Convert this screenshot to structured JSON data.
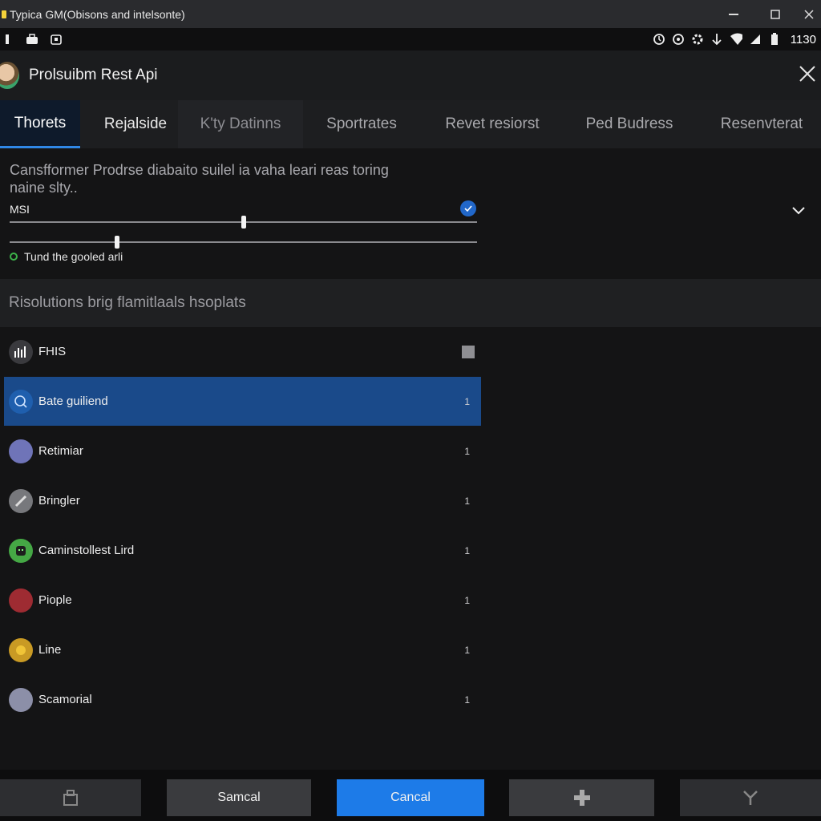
{
  "window": {
    "title": "Typica GM(Obisons and intelsonte)"
  },
  "statusbar": {
    "time": "1130"
  },
  "header": {
    "title": "Prolsuibm Rest Api"
  },
  "tabs": [
    {
      "label": "Thorets",
      "active": true
    },
    {
      "label": "Rejalside"
    },
    {
      "label": "K'ty Datinns"
    },
    {
      "label": "Sportrates"
    },
    {
      "label": "Revet resiorst"
    },
    {
      "label": "Ped Budress"
    },
    {
      "label": "Resenvterat"
    }
  ],
  "panel": {
    "description": "Cansfformer Prodrse diabaito suilel ia vaha leari reas toring naine slty..",
    "slider_label": "MSI",
    "slider1_value": 0.5,
    "slider2_value": 0.23,
    "status_text": "Tund the gooled arli"
  },
  "section": {
    "title": "Risolutions brig flamitlaals hsoplats"
  },
  "list": [
    {
      "label": "FHIS",
      "icon": "equalizer-icon",
      "color": "#3a3a3e"
    },
    {
      "label": "Bate guiliend",
      "count": "1",
      "icon": "user-search-icon",
      "color": "#1f5fae"
    },
    {
      "label": "Retimiar",
      "count": "1",
      "icon": "moon-icon",
      "color": "#6f74b8"
    },
    {
      "label": "Bringler",
      "count": "1",
      "icon": "tool-icon",
      "color": "#77787c"
    },
    {
      "label": "Caminstollest Lird",
      "count": "1",
      "icon": "robot-icon",
      "color": "#45a845"
    },
    {
      "label": "Piople",
      "count": "1",
      "icon": "people-icon",
      "color": "#9e2b32"
    },
    {
      "label": "Line",
      "count": "1",
      "icon": "sun-icon",
      "color": "#c99a24"
    },
    {
      "label": "Scamorial",
      "count": "1",
      "icon": "group-icon",
      "color": "#8c8fa8"
    }
  ],
  "footer": {
    "secondary_label": "Samcal",
    "primary_label": "Cancal"
  },
  "colors": {
    "accent": "#1d7be8",
    "selected_row": "#1a4a8a",
    "status_ok": "#3cb34a"
  }
}
